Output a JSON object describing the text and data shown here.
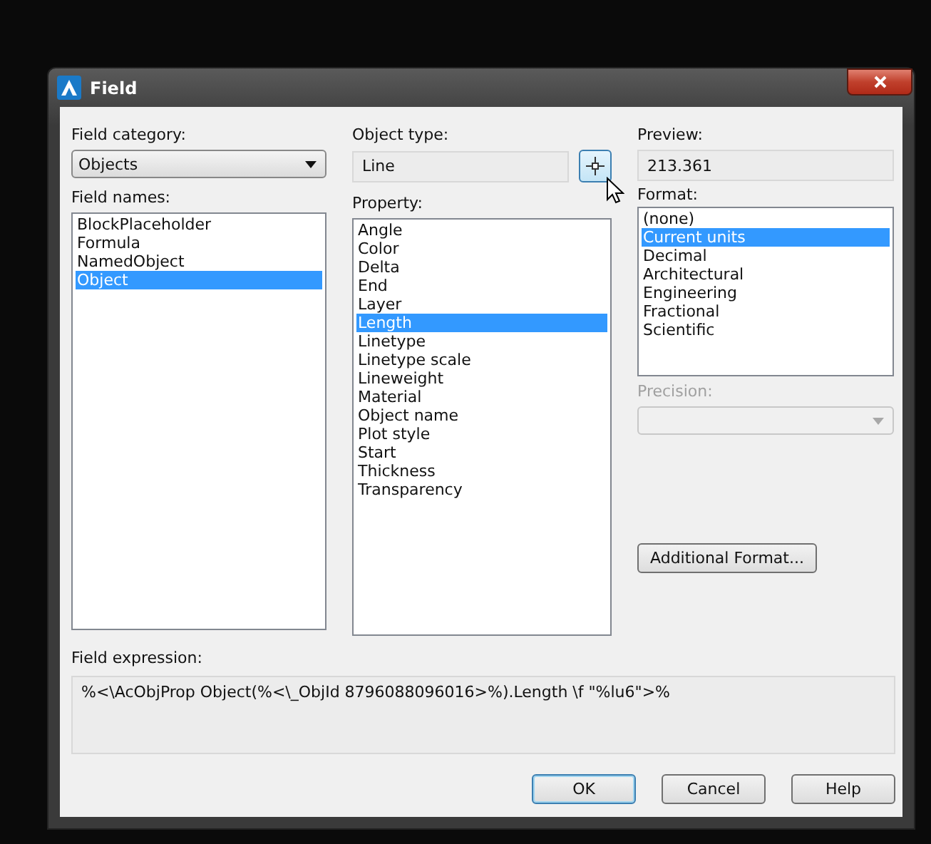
{
  "window": {
    "title": "Field"
  },
  "field_category": {
    "label": "Field category:",
    "value": "Objects"
  },
  "field_names": {
    "label": "Field names:",
    "items": [
      {
        "label": "BlockPlaceholder",
        "selected": false
      },
      {
        "label": "Formula",
        "selected": false
      },
      {
        "label": "NamedObject",
        "selected": false
      },
      {
        "label": "Object",
        "selected": true
      }
    ]
  },
  "object_type": {
    "label": "Object type:",
    "value": "Line"
  },
  "property": {
    "label": "Property:",
    "items": [
      {
        "label": "Angle",
        "selected": false
      },
      {
        "label": "Color",
        "selected": false
      },
      {
        "label": "Delta",
        "selected": false
      },
      {
        "label": "End",
        "selected": false
      },
      {
        "label": "Layer",
        "selected": false
      },
      {
        "label": "Length",
        "selected": true
      },
      {
        "label": "Linetype",
        "selected": false
      },
      {
        "label": "Linetype scale",
        "selected": false
      },
      {
        "label": "Lineweight",
        "selected": false
      },
      {
        "label": "Material",
        "selected": false
      },
      {
        "label": "Object name",
        "selected": false
      },
      {
        "label": "Plot style",
        "selected": false
      },
      {
        "label": "Start",
        "selected": false
      },
      {
        "label": "Thickness",
        "selected": false
      },
      {
        "label": "Transparency",
        "selected": false
      }
    ]
  },
  "preview": {
    "label": "Preview:",
    "value": "213.361"
  },
  "format": {
    "label": "Format:",
    "items": [
      {
        "label": "(none)",
        "selected": false
      },
      {
        "label": "Current units",
        "selected": true
      },
      {
        "label": "Decimal",
        "selected": false
      },
      {
        "label": "Architectural",
        "selected": false
      },
      {
        "label": "Engineering",
        "selected": false
      },
      {
        "label": "Fractional",
        "selected": false
      },
      {
        "label": "Scientific",
        "selected": false
      }
    ]
  },
  "precision": {
    "label": "Precision:",
    "disabled": true
  },
  "additional_format_button": "Additional Format...",
  "field_expression": {
    "label": "Field expression:",
    "value": "%<\\AcObjProp Object(%<\\_ObjId 8796088096016>%).Length \\f \"%lu6\">%"
  },
  "buttons": [
    {
      "label": "OK",
      "default": true
    },
    {
      "label": "Cancel",
      "default": false
    },
    {
      "label": "Help",
      "default": false
    }
  ]
}
